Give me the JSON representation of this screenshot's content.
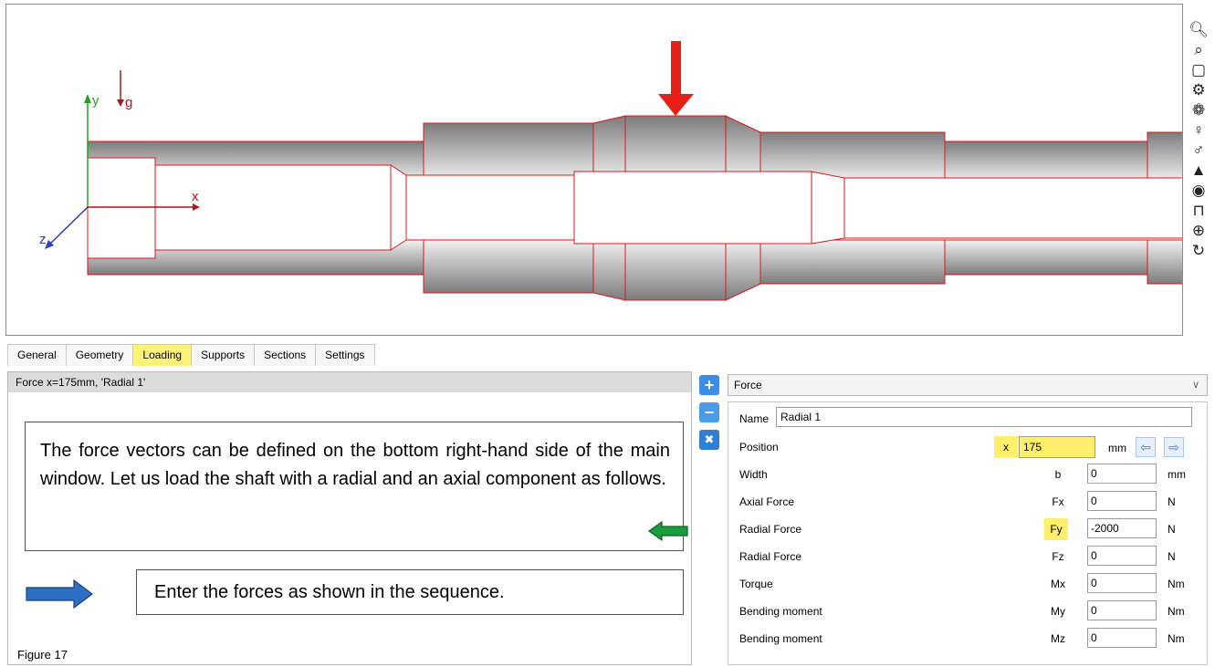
{
  "viewport": {
    "axes": {
      "y": "y",
      "g": "g",
      "x": "x",
      "z": "z"
    },
    "colors": {
      "shaft_outline": "#d81818",
      "force_arrow": "#e8201a",
      "axis_y": "#21a321",
      "axis_x": "#b01414",
      "axis_z": "#2a3fb8"
    }
  },
  "toolbar": {
    "icons": [
      "zoom-in-icon",
      "zoom-out-icon",
      "zoom-fit-icon",
      "gear-icon",
      "bearing-icon",
      "mass-icon",
      "shaft-force-icon",
      "support-icon",
      "ring-icon",
      "bottom-view-icon",
      "top-view-icon",
      "rotation-icon"
    ]
  },
  "tabs": [
    {
      "label": "General"
    },
    {
      "label": "Geometry"
    },
    {
      "label": "Loading",
      "active": true
    },
    {
      "label": "Supports"
    },
    {
      "label": "Sections"
    },
    {
      "label": "Settings"
    }
  ],
  "list": {
    "header": "Force  x=175mm, 'Radial 1'"
  },
  "notes": {
    "main": "The force vectors can be defined on the bottom right-hand side of the main window. Let us load the shaft with a radial and an axial component as follows.",
    "secondary": "Enter the forces as shown in the sequence.",
    "caption": "Figure 17"
  },
  "side_buttons": {
    "add": "+",
    "remove": "−",
    "delete": "✖"
  },
  "force_type": "Force",
  "form": {
    "name_label": "Name",
    "name_value": "Radial 1",
    "position": {
      "label": "Position",
      "symbol": "x",
      "value": "175",
      "unit": "mm"
    },
    "rows": [
      {
        "label": "Width",
        "symbol": "b",
        "value": "0",
        "unit": "mm"
      },
      {
        "label": "Axial Force",
        "symbol": "Fx",
        "value": "0",
        "unit": "N"
      },
      {
        "label": "Radial Force",
        "symbol": "Fy",
        "value": "-2000",
        "unit": "N",
        "highlight": true
      },
      {
        "label": "Radial Force",
        "symbol": "Fz",
        "value": "0",
        "unit": "N"
      },
      {
        "label": "Torque",
        "symbol": "Mx",
        "value": "0",
        "unit": "Nm"
      },
      {
        "label": "Bending moment",
        "symbol": "My",
        "value": "0",
        "unit": "Nm"
      },
      {
        "label": "Bending moment",
        "symbol": "Mz",
        "value": "0",
        "unit": "Nm"
      }
    ]
  }
}
